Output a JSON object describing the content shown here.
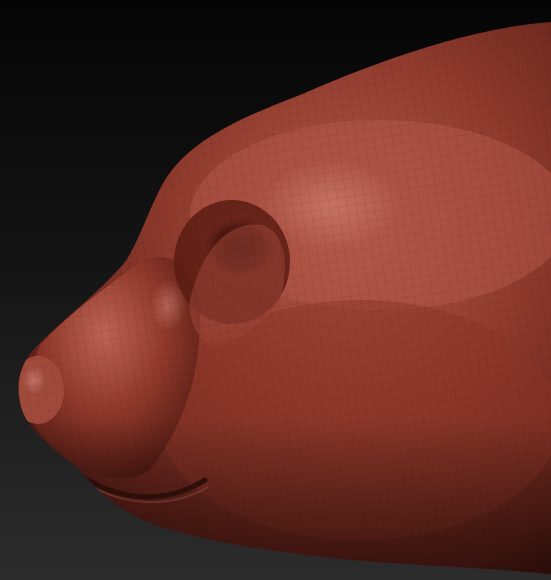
{
  "scene": {
    "subject": "sculpted-animal-snout",
    "colors": {
      "background_top": "#050505",
      "background_bottom": "#2c2c2c",
      "material_base": "#8a3528",
      "material_light": "#c46a5c",
      "material_shadow": "#3a120c",
      "highlight": "#e8a396"
    }
  }
}
